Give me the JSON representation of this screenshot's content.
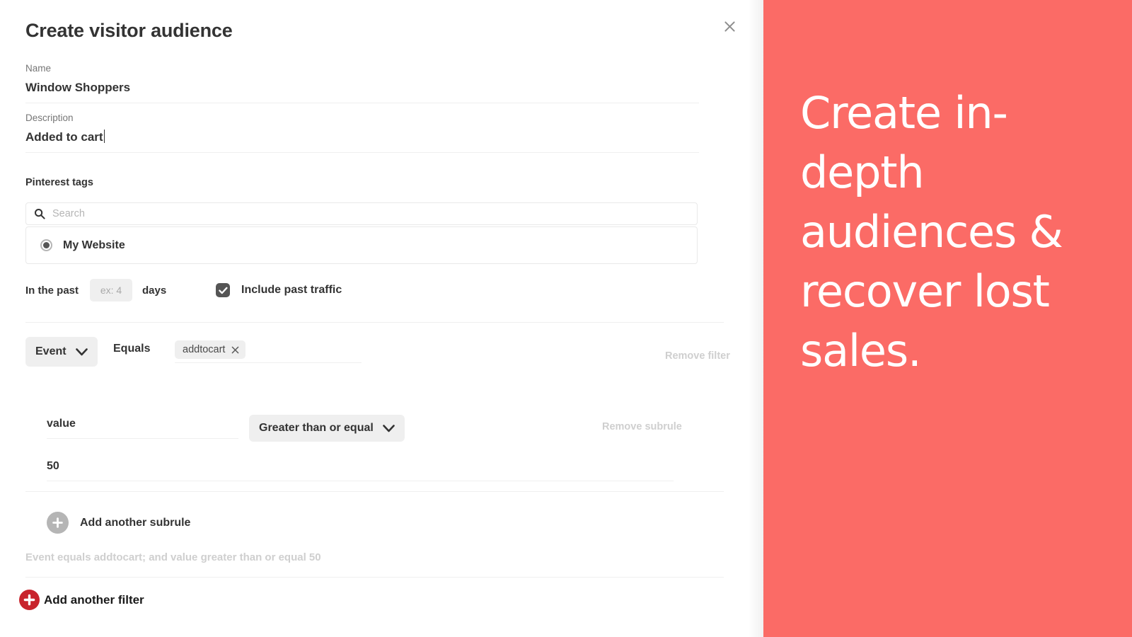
{
  "modal": {
    "title": "Create visitor audience",
    "close_icon": "close-icon"
  },
  "fields": {
    "name": {
      "label": "Name",
      "value": "Window Shoppers"
    },
    "description": {
      "label": "Description",
      "value": "Added to cart"
    }
  },
  "tags_section": {
    "label": "Pinterest tags",
    "search_placeholder": "Search",
    "search_value": "",
    "search_icon": "search-icon",
    "items": [
      {
        "label": "My Website",
        "selected": true
      }
    ]
  },
  "lookback": {
    "prefix_label": "In the past",
    "days_placeholder": "ex: 4",
    "days_value": "",
    "suffix_label": "days",
    "include_past_traffic_label": "Include past traffic",
    "include_past_traffic_checked": true
  },
  "filter": {
    "field_select_value": "Event",
    "operator_label": "Equals",
    "tokens": [
      {
        "label": "addtocart",
        "remove_icon": "close-icon"
      }
    ],
    "remove_filter_label": "Remove filter",
    "subrule": {
      "key_value": "value",
      "operator_select_value": "Greater than or equal",
      "value": "50",
      "remove_subrule_label": "Remove subrule"
    },
    "add_subrule_label": "Add another subrule",
    "summary": "Event equals addtocart; and value greater than or equal 50",
    "add_filter_label": "Add another filter"
  },
  "promo": {
    "headline": "Create in-depth audiences & recover lost sales.",
    "background_color": "#fb6b66",
    "text_color": "#ffffff"
  },
  "colors": {
    "accent_red": "#c8232c",
    "text_primary": "#333333",
    "text_muted": "#767676",
    "text_faint": "#cfcfcf",
    "chip_bg": "#efefef",
    "border": "#e9e9e9"
  }
}
